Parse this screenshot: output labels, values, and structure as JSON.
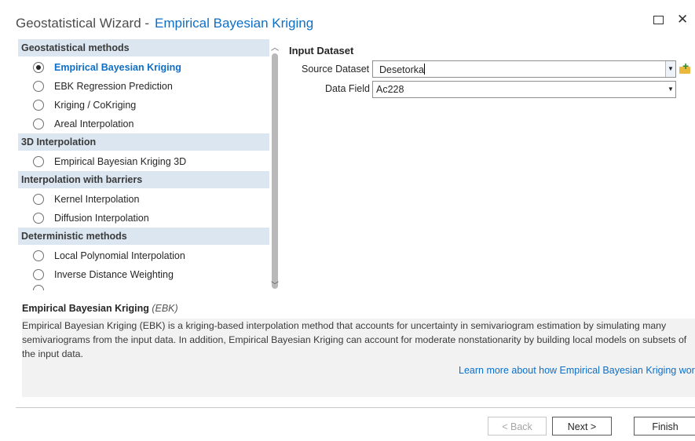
{
  "window": {
    "title": "Geostatistical Wizard",
    "separator": "-",
    "subtitle": "Empirical Bayesian Kriging"
  },
  "methods": [
    {
      "group": "Geostatistical methods",
      "items": [
        {
          "label": "Empirical Bayesian Kriging",
          "selected": true
        },
        {
          "label": "EBK Regression Prediction",
          "selected": false
        },
        {
          "label": "Kriging / CoKriging",
          "selected": false
        },
        {
          "label": "Areal Interpolation",
          "selected": false
        }
      ]
    },
    {
      "group": "3D Interpolation",
      "items": [
        {
          "label": "Empirical Bayesian Kriging 3D",
          "selected": false
        }
      ]
    },
    {
      "group": "Interpolation with barriers",
      "items": [
        {
          "label": "Kernel Interpolation",
          "selected": false
        },
        {
          "label": "Diffusion Interpolation",
          "selected": false
        }
      ]
    },
    {
      "group": "Deterministic methods",
      "items": [
        {
          "label": "Local Polynomial Interpolation",
          "selected": false
        },
        {
          "label": "Inverse Distance Weighting",
          "selected": false
        }
      ]
    }
  ],
  "input": {
    "section_title": "Input Dataset",
    "source_label": "Source Dataset",
    "source_value": "Desetorka",
    "field_label": "Data Field",
    "field_value": "Ac228"
  },
  "description": {
    "title": "Empirical Bayesian Kriging",
    "abbr": "(EBK)",
    "text": "Empirical Bayesian Kriging (EBK) is a kriging-based interpolation method that accounts for uncertainty in semivariogram estimation by simulating many semivariograms from the input data. In addition, Empirical Bayesian Kriging can account for moderate nonstationarity by building local models on subsets of the input data.",
    "link": "Learn more about how Empirical Bayesian Kriging works"
  },
  "buttons": {
    "back": "< Back",
    "next": "Next >",
    "finish": "Finish"
  },
  "icons": {
    "maximize": "maximize-icon",
    "close": "close-icon",
    "dropdown": "chevron-down-icon",
    "add_data": "add-data-icon",
    "scroll_up": "chevron-up-icon",
    "scroll_down": "chevron-down-icon"
  },
  "colors": {
    "accent": "#0f6fc6",
    "group_header_bg": "#dbe6f1",
    "description_bg": "#f2f2f2"
  }
}
